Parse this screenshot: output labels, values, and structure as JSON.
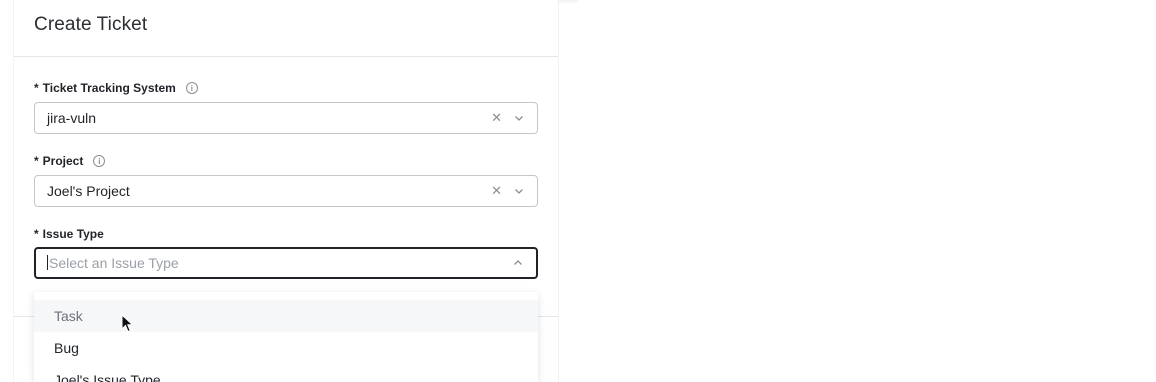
{
  "header": {
    "title": "Create Ticket"
  },
  "form": {
    "required_mark": "*",
    "info_icon": "info-icon",
    "ticket_system": {
      "label": "Ticket Tracking System",
      "value": "jira-vuln",
      "clear_icon": "close-icon",
      "chevron": "chevron-down-icon"
    },
    "project": {
      "label": "Project",
      "value": "Joel's Project",
      "clear_icon": "close-icon",
      "chevron": "chevron-down-icon"
    },
    "issue_type": {
      "label": "Issue Type",
      "placeholder": "Select an Issue Type",
      "chevron": "chevron-up-icon"
    }
  },
  "dropdown": {
    "options": [
      "Task",
      "Bug",
      "Joel's Issue Type"
    ]
  },
  "colors": {
    "text": "#1f2328",
    "placeholder": "#9aa0a6",
    "border": "#c3c6ca",
    "hover": "#f6f7f8"
  }
}
